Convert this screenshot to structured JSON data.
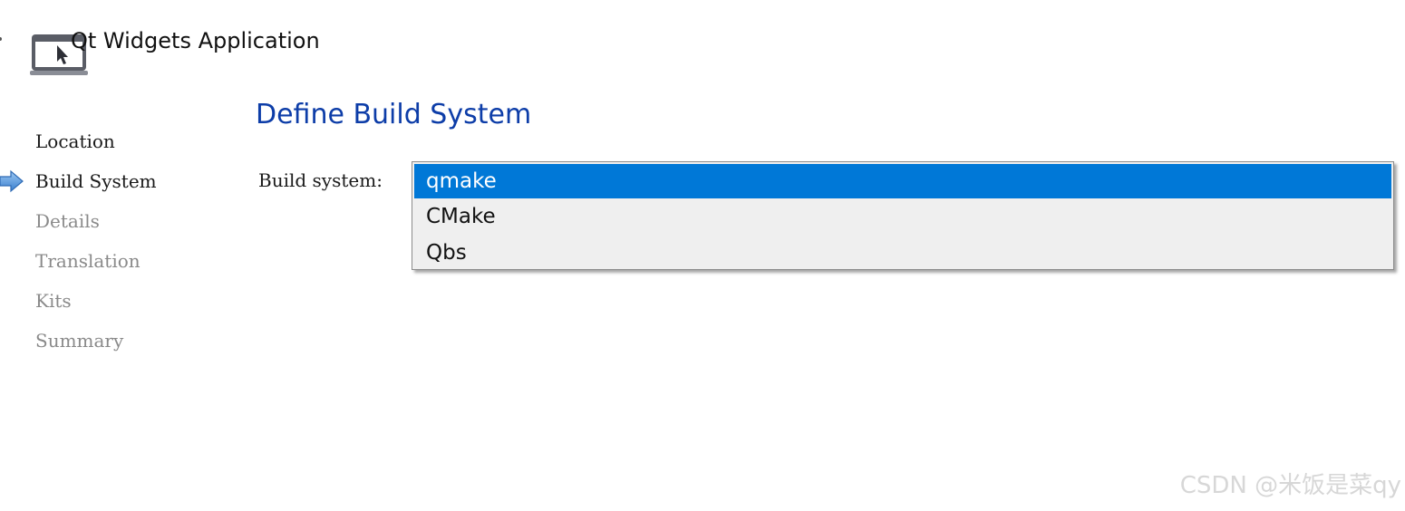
{
  "header": {
    "title": "Qt Widgets Application",
    "icon": "window-cursor-icon"
  },
  "sidebar": {
    "steps": [
      {
        "label": "Location",
        "state": "done"
      },
      {
        "label": "Build System",
        "state": "current"
      },
      {
        "label": "Details",
        "state": "pending"
      },
      {
        "label": "Translation",
        "state": "pending"
      },
      {
        "label": "Kits",
        "state": "pending"
      },
      {
        "label": "Summary",
        "state": "pending"
      }
    ],
    "current_marker_icon": "arrow-right-icon"
  },
  "main": {
    "heading": "Define Build System",
    "field_label": "Build system:",
    "dropdown": {
      "selected": "qmake",
      "options": [
        "qmake",
        "CMake",
        "Qbs"
      ]
    }
  },
  "watermark": "CSDN @米饭是菜qy",
  "colors": {
    "heading": "#0d3da8",
    "selection": "#0078d7",
    "dropdown_bg": "#efefef",
    "pending_text": "#8a8a8a",
    "arrow": "#4a90d9"
  }
}
